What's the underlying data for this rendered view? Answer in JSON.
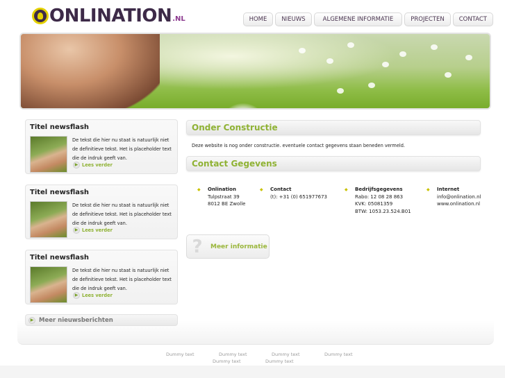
{
  "brand": {
    "name": "ONLINATION",
    "tld": ".NL"
  },
  "nav": [
    "HOME",
    "NIEUWS",
    "ALGEMENE INFORMATIE",
    "PROJECTEN",
    "CONTACT"
  ],
  "news": [
    {
      "title": "Titel newsflash",
      "text": "De tekst die hier nu staat is natuurlijk niet de definitieve tekst. Het is placeholder text die de indruk geeft van.",
      "more": "Lees verder"
    },
    {
      "title": "Titel newsflash",
      "text": "De tekst die hier nu staat is natuurlijk niet de definitieve tekst. Het is placeholder text die de indruk geeft van.",
      "more": "Lees verder"
    },
    {
      "title": "Titel newsflash",
      "text": "De tekst die hier nu staat is natuurlijk niet de definitieve tekst. Het is placeholder text die de indruk geeft van.",
      "more": "Lees verder"
    }
  ],
  "more_news": "Meer nieuwsberichten",
  "construction": {
    "title": "Onder Constructie",
    "text": "Deze website is nog onder constructie. eventuele contact gegevens staan beneden vermeld."
  },
  "contact": {
    "title": "Contact Gegevens",
    "columns": [
      {
        "head": "Onlination",
        "lines": [
          "Tulpstraat 39",
          "8012 BE Zwolle"
        ]
      },
      {
        "head": "Contact",
        "lines": [
          "(t): +31 (0) 651977673"
        ]
      },
      {
        "head": "Bedrijfsgegevens",
        "lines": [
          "Rabo: 12 08 28 863",
          "KVK: 05081359",
          "BTW: 1053.23.524.B01"
        ]
      },
      {
        "head": "Internet",
        "lines": [
          "info@onlination.nl",
          "www.onlination.nl"
        ]
      }
    ]
  },
  "info_button": "Meer informatie",
  "footer": [
    "Dummy text",
    "Dummy text",
    "Dummy text",
    "Dummy text",
    "Dummy text",
    "Dummy text"
  ],
  "colors": {
    "accent": "#8fb234",
    "brand": "#3d2a48",
    "bullet": "#c9c200"
  }
}
